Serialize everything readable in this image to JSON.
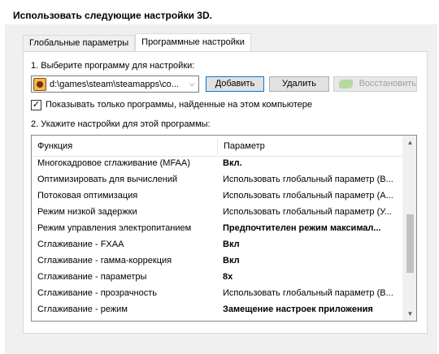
{
  "page_title": "Использовать следующие настройки 3D.",
  "tabs": [
    {
      "label": "Глобальные параметры"
    },
    {
      "label": "Программные настройки"
    }
  ],
  "step1_label": "1. Выберите программу для настройки:",
  "program_select": {
    "value": "d:\\games\\steam\\steamapps\\co..."
  },
  "buttons": {
    "add": "Добавить",
    "remove": "Удалить",
    "restore": "Восстановить"
  },
  "show_only_found": {
    "label": "Показывать только программы, найденные на этом компьютере",
    "checked": true,
    "mark": "✓"
  },
  "step2_label": "2. Укажите настройки для этой программы:",
  "table": {
    "headers": {
      "function": "Функция",
      "parameter": "Параметр"
    },
    "rows": [
      {
        "function": "Многокадровое сглаживание (MFAA)",
        "value": "Вкл.",
        "bold": true
      },
      {
        "function": "Оптимизировать для вычислений",
        "value": "Использовать глобальный параметр (В...",
        "bold": false
      },
      {
        "function": "Потоковая оптимизация",
        "value": "Использовать глобальный параметр (А...",
        "bold": false
      },
      {
        "function": "Режим низкой задержки",
        "value": "Использовать глобальный параметр (У...",
        "bold": false
      },
      {
        "function": "Режим управления электропитанием",
        "value": "Предпочтителен режим максимал...",
        "bold": true
      },
      {
        "function": "Сглаживание - FXAA",
        "value": "Вкл",
        "bold": true
      },
      {
        "function": "Сглаживание - гамма-коррекция",
        "value": "Вкл",
        "bold": true
      },
      {
        "function": "Сглаживание - параметры",
        "value": "8x",
        "bold": true
      },
      {
        "function": "Сглаживание - прозрачность",
        "value": "Использовать глобальный параметр (В...",
        "bold": false
      },
      {
        "function": "Сглаживание - режим",
        "value": "Замещение настроек приложения",
        "bold": true
      }
    ]
  },
  "scrollbar": {
    "up_icon": "▲",
    "down_icon": "▼"
  },
  "select_chevron": "⌵"
}
